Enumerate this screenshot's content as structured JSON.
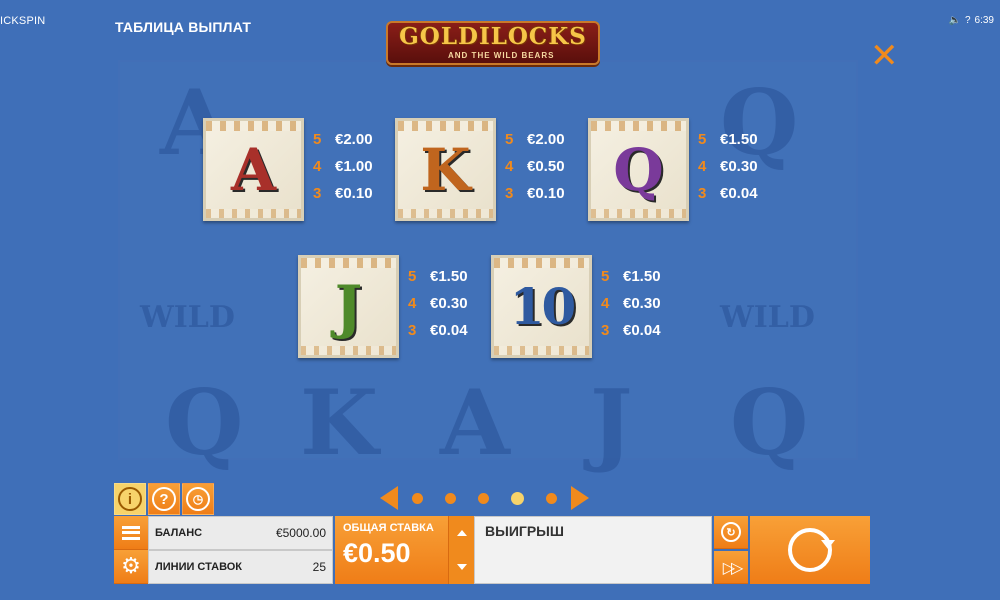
{
  "brand": "ICKSPIN",
  "status": {
    "sound_icon": "speaker-icon",
    "help": "?",
    "time": "6:39"
  },
  "page_title": "ТАБЛИЦА ВЫПЛАТ",
  "logo": {
    "main": "GOLDILOCKS",
    "sub": "AND THE WILD BEARS"
  },
  "close_icon": "close-icon",
  "paytable": [
    {
      "symbol": "A",
      "color": "#a8302a",
      "payouts": [
        {
          "count": "5",
          "value": "€2.00"
        },
        {
          "count": "4",
          "value": "€1.00"
        },
        {
          "count": "3",
          "value": "€0.10"
        }
      ]
    },
    {
      "symbol": "K",
      "color": "#c0651e",
      "payouts": [
        {
          "count": "5",
          "value": "€2.00"
        },
        {
          "count": "4",
          "value": "€0.50"
        },
        {
          "count": "3",
          "value": "€0.10"
        }
      ]
    },
    {
      "symbol": "Q",
      "color": "#7a3a9a",
      "payouts": [
        {
          "count": "5",
          "value": "€1.50"
        },
        {
          "count": "4",
          "value": "€0.30"
        },
        {
          "count": "3",
          "value": "€0.04"
        }
      ]
    },
    {
      "symbol": "J",
      "color": "#4f8a2a",
      "payouts": [
        {
          "count": "5",
          "value": "€1.50"
        },
        {
          "count": "4",
          "value": "€0.30"
        },
        {
          "count": "3",
          "value": "€0.04"
        }
      ]
    },
    {
      "symbol": "10",
      "color": "#2f5aa0",
      "payouts": [
        {
          "count": "5",
          "value": "€1.50"
        },
        {
          "count": "4",
          "value": "€0.30"
        },
        {
          "count": "3",
          "value": "€0.04"
        }
      ]
    }
  ],
  "pager": {
    "pages": 5,
    "active_page": 4
  },
  "bottom": {
    "balance_label": "БАЛАНС",
    "balance_value": "€5000.00",
    "lines_label": "ЛИНИИ СТАВОК",
    "lines_value": "25",
    "total_bet_label": "ОБЩАЯ СТАВКА",
    "total_bet_value": "€0.50",
    "win_label": "ВЫИГРЫШ"
  },
  "colors": {
    "background": "#3f6fb8",
    "accent": "#f08a1d",
    "accent_active": "#f7d36a"
  },
  "icons": [
    "info-icon",
    "help-icon",
    "history-icon",
    "menu-icon",
    "settings-icon",
    "autoplay-icon",
    "fast-forward-icon",
    "spin-icon"
  ]
}
